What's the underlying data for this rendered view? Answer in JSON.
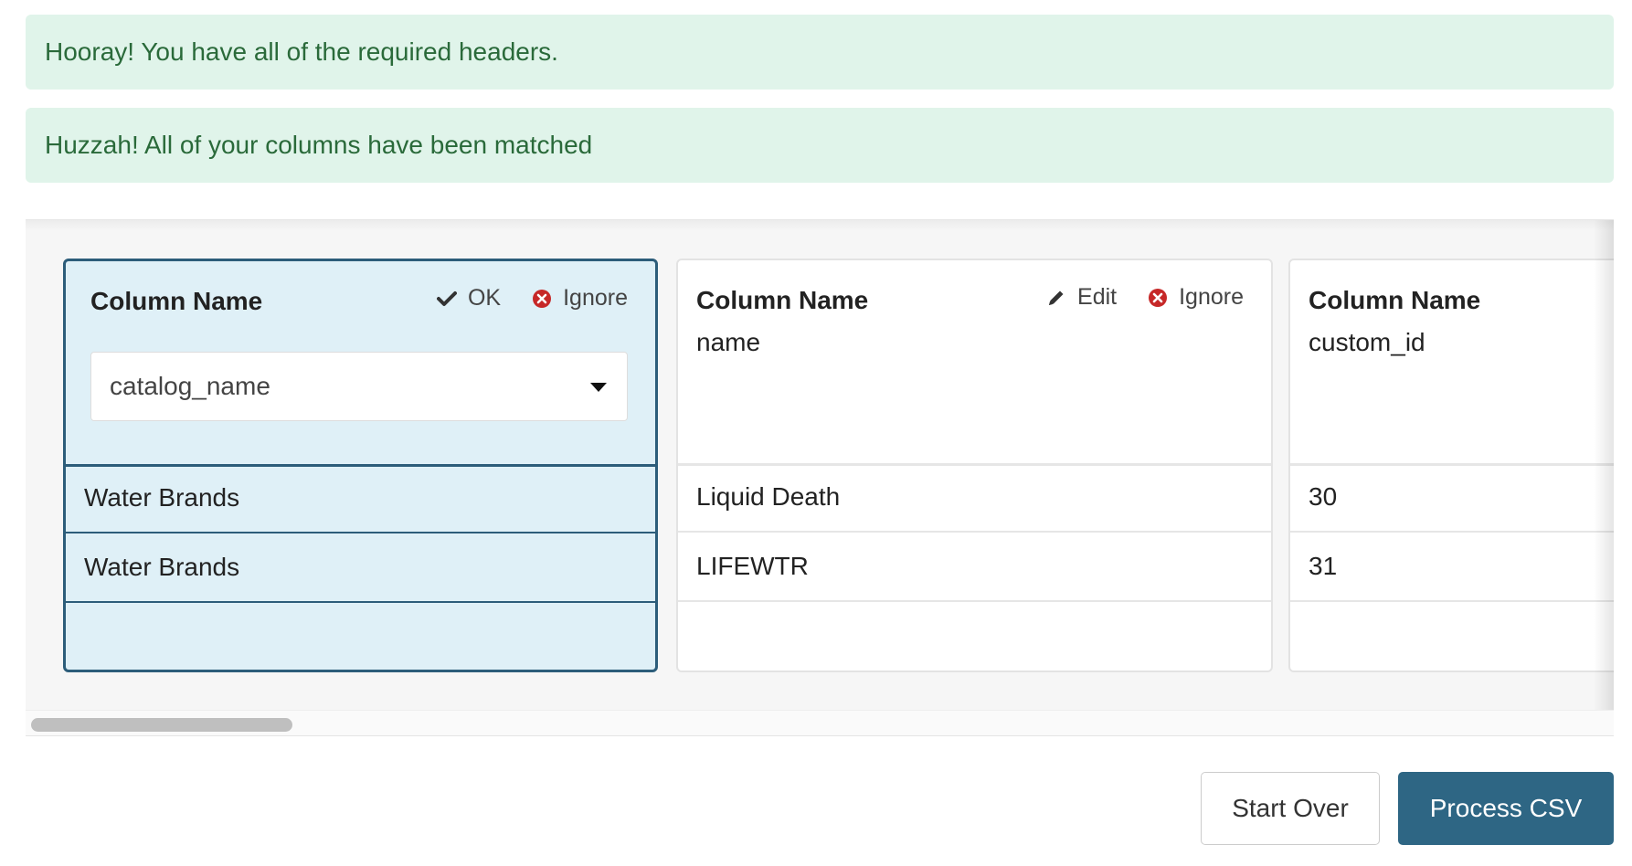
{
  "alerts": [
    {
      "text": "Hooray! You have all of the required headers."
    },
    {
      "text": "Huzzah! All of your columns have been matched"
    }
  ],
  "columns": [
    {
      "title": "Column Name",
      "selected": true,
      "actions": {
        "primary": "OK",
        "secondary": "Ignore"
      },
      "select_value": "catalog_name",
      "rows": [
        "Water Brands",
        "Water Brands",
        ""
      ]
    },
    {
      "title": "Column Name",
      "selected": false,
      "header_value": "name",
      "actions": {
        "primary": "Edit",
        "secondary": "Ignore"
      },
      "rows": [
        "Liquid Death",
        "LIFEWTR",
        ""
      ]
    },
    {
      "title": "Column Name",
      "selected": false,
      "header_value": "custom_id",
      "rows": [
        "30",
        "31",
        ""
      ]
    }
  ],
  "buttons": {
    "start_over": "Start Over",
    "process_csv": "Process CSV"
  },
  "colors": {
    "alert_bg": "#e0f4ea",
    "alert_text": "#2a6a3a",
    "selected_bg": "#dff0f7",
    "selected_border": "#2c5d7a",
    "primary_button": "#2e6684",
    "ignore_icon": "#c62828"
  },
  "icons": [
    "check-icon",
    "close-circle-icon",
    "pencil-icon",
    "caret-down-icon"
  ]
}
